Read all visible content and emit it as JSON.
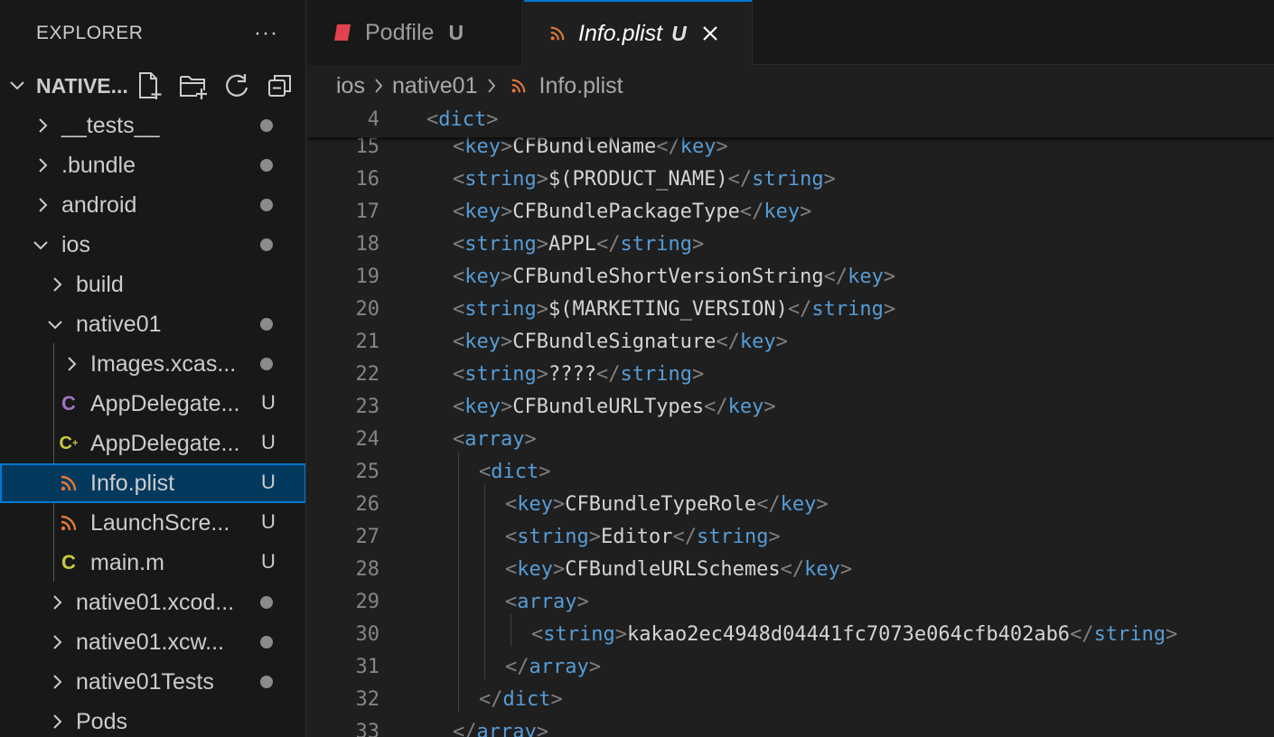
{
  "sidebar": {
    "title": "EXPLORER",
    "more_icon": "ellipsis-icon",
    "section_title": "NATIVE...",
    "actions": [
      "new-file-icon",
      "new-folder-icon",
      "refresh-icon",
      "collapse-all-icon"
    ],
    "items": [
      {
        "label": "__tests__",
        "type": "folder",
        "expanded": false,
        "status": "dot"
      },
      {
        "label": ".bundle",
        "type": "folder",
        "expanded": false,
        "status": "dot"
      },
      {
        "label": "android",
        "type": "folder",
        "expanded": false,
        "status": "dot"
      },
      {
        "label": "ios",
        "type": "folder",
        "expanded": true,
        "status": "dot"
      },
      {
        "label": "build",
        "type": "folder",
        "expanded": false,
        "status": ""
      },
      {
        "label": "native01",
        "type": "folder",
        "expanded": true,
        "status": "dot"
      },
      {
        "label": "Images.xcas...",
        "type": "folder",
        "expanded": false,
        "status": "dot"
      },
      {
        "label": "AppDelegate...",
        "type": "objc-header",
        "icon_text": "C",
        "status": "U"
      },
      {
        "label": "AppDelegate...",
        "type": "objc-cpp",
        "icon_text": "C+",
        "status": "U"
      },
      {
        "label": "Info.plist",
        "type": "plist",
        "status": "U",
        "selected": true
      },
      {
        "label": "LaunchScre...",
        "type": "plist",
        "status": "U"
      },
      {
        "label": "main.m",
        "type": "objc",
        "icon_text": "C",
        "status": "U"
      },
      {
        "label": "native01.xcod...",
        "type": "folder",
        "expanded": false,
        "status": "dot"
      },
      {
        "label": "native01.xcw...",
        "type": "folder",
        "expanded": false,
        "status": "dot"
      },
      {
        "label": "native01Tests",
        "type": "folder",
        "expanded": false,
        "status": "dot"
      },
      {
        "label": "Pods",
        "type": "folder",
        "expanded": false,
        "status": ""
      }
    ]
  },
  "tabs": [
    {
      "label": "Podfile",
      "badge": "U",
      "active": false
    },
    {
      "label": "Info.plist",
      "badge": "U",
      "active": true
    }
  ],
  "breadcrumb": [
    "ios",
    "native01",
    "Info.plist"
  ],
  "code": {
    "sticky": {
      "line": "4",
      "text": "<dict>"
    },
    "lines": [
      {
        "n": "15",
        "text": "<key>CFBundleName</key>"
      },
      {
        "n": "16",
        "text": "<string>$(PRODUCT_NAME)</string>"
      },
      {
        "n": "17",
        "text": "<key>CFBundlePackageType</key>"
      },
      {
        "n": "18",
        "text": "<string>APPL</string>"
      },
      {
        "n": "19",
        "text": "<key>CFBundleShortVersionString</key>"
      },
      {
        "n": "20",
        "text": "<string>$(MARKETING_VERSION)</string>"
      },
      {
        "n": "21",
        "text": "<key>CFBundleSignature</key>"
      },
      {
        "n": "22",
        "text": "<string>????</string>"
      },
      {
        "n": "23",
        "text": "<key>CFBundleURLTypes</key>"
      },
      {
        "n": "24",
        "text": "<array>"
      },
      {
        "n": "25",
        "text": "<dict>"
      },
      {
        "n": "26",
        "text": "<key>CFBundleTypeRole</key>"
      },
      {
        "n": "27",
        "text": "<string>Editor</string>"
      },
      {
        "n": "28",
        "text": "<key>CFBundleURLSchemes</key>"
      },
      {
        "n": "29",
        "text": "<array>"
      },
      {
        "n": "30",
        "text": "<string>kakao2ec4948d04441fc7073e064cfb402ab6</string>"
      },
      {
        "n": "31",
        "text": "</array>"
      },
      {
        "n": "32",
        "text": "</dict>"
      },
      {
        "n": "33",
        "text": "</array>"
      }
    ]
  },
  "colors": {
    "tag": "#569cd6",
    "bracket": "#808080",
    "text": "#d4d4d4",
    "accent": "#0078d4",
    "selection": "#04395e",
    "plist_icon": "#e37933",
    "objc_icon": "#a074c4",
    "objcpp_icon": "#cbcb41",
    "ruby_icon": "#e0434f"
  }
}
